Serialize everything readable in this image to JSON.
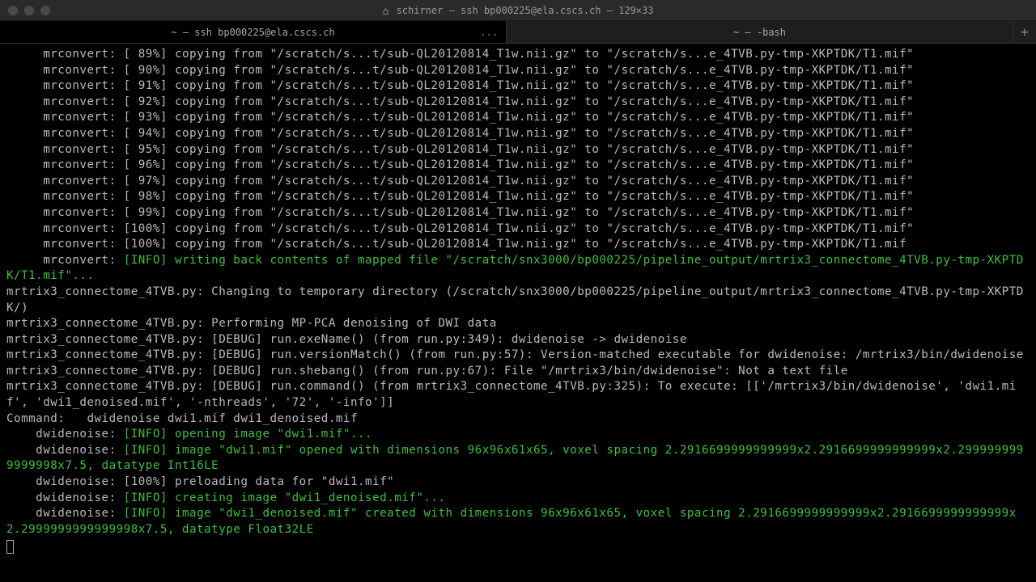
{
  "window": {
    "title_prefix": "schirner — ssh bp000225@ela.cscs.ch — 129×33"
  },
  "tabs": [
    {
      "label": "~ — ssh bp000225@ela.cscs.ch",
      "ellipsis": "..."
    },
    {
      "label": "~ — -bash",
      "ellipsis": ""
    }
  ],
  "progress": {
    "prefix": "     mrconvert: [",
    "suffix_a": "%] copying from \"/scratch/s...t/sub-QL20120814_T1w.nii.gz\" to \"/scratch/s...e_4TVB.py-tmp-XKPTDK/T1.mif\"",
    "suffix_b": "%] copying from \"/scratch/s...t/sub-QL20120814_T1w.nii.gz\" to \"/scratch/s...e_4TVB.py-tmp-XKPTDK/T1.mif",
    "percents": [
      " 89",
      " 90",
      " 91",
      " 92",
      " 93",
      " 94",
      " 95",
      " 96",
      " 97",
      " 98",
      " 99",
      "100",
      "100"
    ]
  },
  "info1_a": "     mrconvert: ",
  "info1_b": "[INFO] writing back contents of mapped file \"/scratch/snx3000/bp000225/pipeline_output/mrtrix3_connectome_4TVB.py-tmp-XKPTDK/T1.mif\"...",
  "l_changing": "mrtrix3_connectome_4TVB.py: Changing to temporary directory (/scratch/snx3000/bp000225/pipeline_output/mrtrix3_connectome_4TVB.py-tmp-XKPTDK/)",
  "l_perform": "mrtrix3_connectome_4TVB.py: Performing MP-PCA denoising of DWI data",
  "l_dbg1": "mrtrix3_connectome_4TVB.py: [DEBUG] run.exeName() (from run.py:349): dwidenoise -> dwidenoise",
  "l_dbg2": "mrtrix3_connectome_4TVB.py: [DEBUG] run.versionMatch() (from run.py:57): Version-matched executable for dwidenoise: /mrtrix3/bin/dwidenoise",
  "l_dbg3": "mrtrix3_connectome_4TVB.py: [DEBUG] run.shebang() (from run.py:67): File \"/mrtrix3/bin/dwidenoise\": Not a text file",
  "l_dbg4": "mrtrix3_connectome_4TVB.py: [DEBUG] run.command() (from mrtrix3_connectome_4TVB.py:325): To execute: [['/mrtrix3/bin/dwidenoise', 'dwi1.mif', 'dwi1_denoised.mif', '-nthreads', '72', '-info']]",
  "l_cmd": "Command:   dwidenoise dwi1.mif dwi1_denoised.mif",
  "dw_prefix": "    dwidenoise: ",
  "dw_open": "[INFO] opening image \"dwi1.mif\"...",
  "dw_opened": "[INFO] image \"dwi1.mif\" opened with dimensions 96x96x61x65, voxel spacing 2.2916699999999999x2.2916699999999999x2.2999999999999998x7.5, datatype Int16LE",
  "dw_preload": "    dwidenoise: [100%] preloading data for \"dwi1.mif\"",
  "dw_create": "[INFO] creating image \"dwi1_denoised.mif\"...",
  "dw_created": "[INFO] image \"dwi1_denoised.mif\" created with dimensions 96x96x61x65, voxel spacing 2.2916699999999999x2.2916699999999999x2.2999999999999998x7.5, datatype Float32LE"
}
